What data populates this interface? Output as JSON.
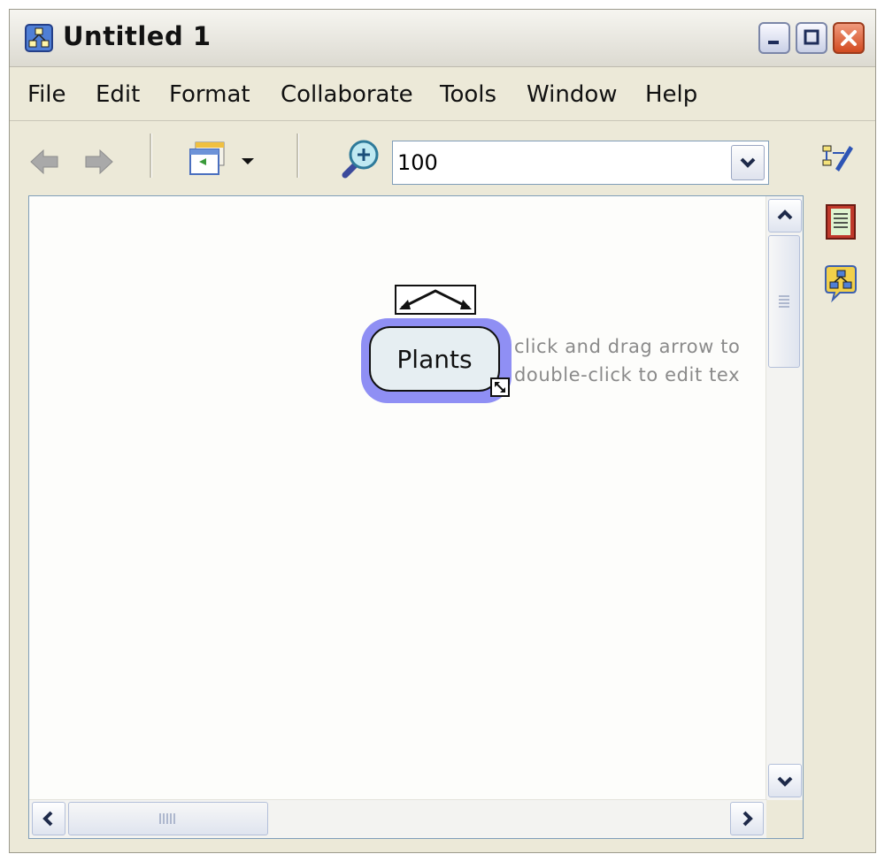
{
  "window": {
    "title": "Untitled 1"
  },
  "menu": [
    "File",
    "Edit",
    "Format",
    "Collaborate",
    "Tools",
    "Window",
    "Help"
  ],
  "toolbar": {
    "back_icon": "back-arrow-icon",
    "forward_icon": "forward-arrow-icon",
    "view_icon": "view-options-icon",
    "zoom_icon": "zoom-in-icon",
    "zoom_value": "100"
  },
  "side_panel": {
    "icons": [
      "styles-icon",
      "notes-icon",
      "views-icon"
    ]
  },
  "canvas": {
    "concept": {
      "label": "Plants"
    },
    "hint_lines": [
      "click and drag arrow to",
      "double-click to edit tex"
    ]
  },
  "colors": {
    "concept_highlight": "#8f8ff4",
    "concept_fill": "#e6eef2",
    "close_button": "#d24a20"
  }
}
